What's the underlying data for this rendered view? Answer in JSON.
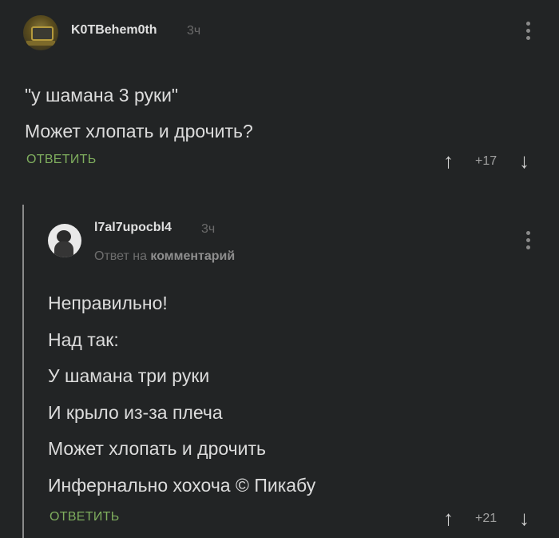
{
  "comments": [
    {
      "username": "K0TBehem0th",
      "time": "3ч",
      "lines": [
        "\"у шамана 3 руки\"",
        "Может хлопать и дрочить?"
      ],
      "reply_label": "ОТВЕТИТЬ",
      "score": "+17"
    },
    {
      "username": "l7al7upocbl4",
      "time": "3ч",
      "reply_to_prefix": "Ответ на",
      "reply_to_target": "комментарий",
      "lines": [
        "Неправильно!",
        "Над так:",
        "У шамана три руки",
        "И крыло из-за плеча",
        "Может хлопать и дрочить",
        "Инфернально хохоча © Пикабу"
      ],
      "reply_label": "ОТВЕТИТЬ",
      "score": "+21"
    }
  ],
  "icons": {
    "upvote": "↑",
    "downvote": "↓",
    "more": "more-vertical-icon"
  },
  "colors": {
    "background": "#222425",
    "reply_link": "#7fae5e",
    "text": "#dcdcdc"
  }
}
